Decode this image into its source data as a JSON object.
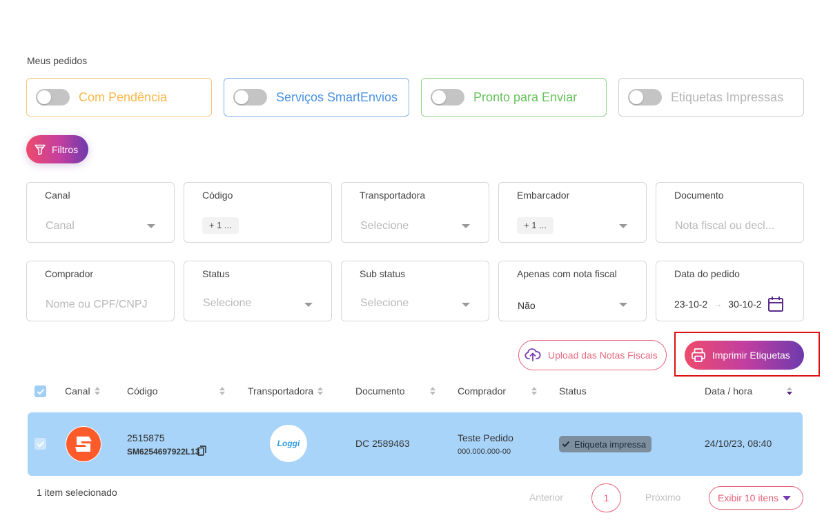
{
  "page": {
    "title": "Meus pedidos"
  },
  "toggles": [
    {
      "label": "Com Pendência",
      "color": "#f7b84b"
    },
    {
      "label": "Serviços SmartEnvios",
      "color": "#4a90e2"
    },
    {
      "label": "Pronto para Enviar",
      "color": "#66c25a"
    },
    {
      "label": "Etiquetas Impressas",
      "color": "#c4c4c4"
    }
  ],
  "filters_button": {
    "label": "Filtros"
  },
  "fields": {
    "canal": {
      "label": "Canal",
      "placeholder": "Canal"
    },
    "codigo": {
      "label": "Código",
      "tag": "+ 1 ..."
    },
    "transportadora": {
      "label": "Transportadora",
      "placeholder": "Selecione"
    },
    "embarcador": {
      "label": "Embarcador",
      "tag": "+ 1 ..."
    },
    "documento": {
      "label": "Documento",
      "placeholder": "Nota fiscal ou decl..."
    },
    "comprador": {
      "label": "Comprador",
      "placeholder": "Nome ou CPF/CNPJ"
    },
    "status": {
      "label": "Status",
      "placeholder": "Selecione"
    },
    "sub_status": {
      "label": "Sub status",
      "placeholder": "Selecione"
    },
    "nota_fiscal": {
      "label": "Apenas com nota fiscal",
      "value": "Não"
    },
    "data_pedido": {
      "label": "Data do pedido",
      "start": "23-10-2",
      "end": "30-10-2"
    }
  },
  "actions": {
    "upload_label": "Upload das Notas Fiscais",
    "print_label": "Imprimir Etiquetas"
  },
  "table": {
    "headers": {
      "canal": "Canal",
      "codigo": "Código",
      "transportadora": "Transportadora",
      "documento": "Documento",
      "comprador": "Comprador",
      "status": "Status",
      "data_hora": "Data / hora"
    },
    "rows": [
      {
        "codigo": "2515875",
        "codigo_sub": "SM6254697922L13",
        "transportadora_logo": "Loggi",
        "documento": "DC 2589463",
        "comprador": "Teste Pedido",
        "comprador_doc": "000.000.000-00",
        "status": "Etiqueta impressa",
        "data_hora": "24/10/23, 08:40"
      }
    ]
  },
  "footer": {
    "selected": "1 item selecionado",
    "prev": "Anterior",
    "page": "1",
    "next": "Próximo",
    "page_size": "Exibir 10 itens"
  }
}
